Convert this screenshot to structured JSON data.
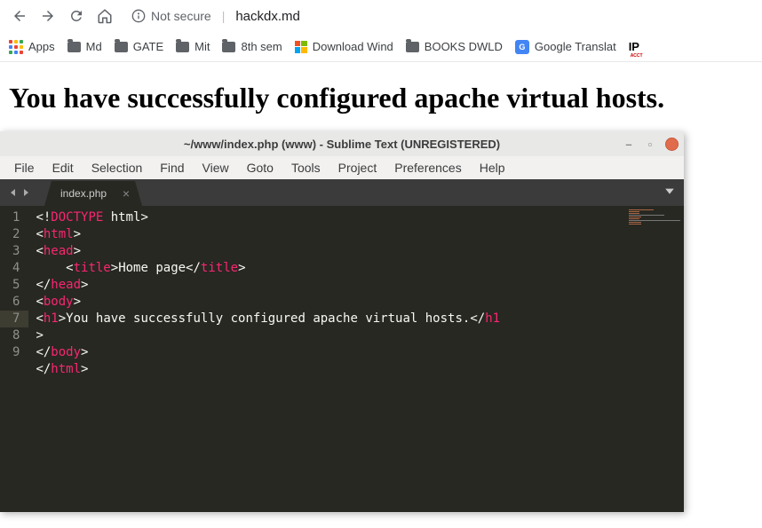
{
  "browser": {
    "security_label": "Not secure",
    "url": "hackdx.md"
  },
  "bookmarks": {
    "apps_label": "Apps",
    "items": [
      {
        "label": "Md",
        "icon": "folder"
      },
      {
        "label": "GATE",
        "icon": "folder"
      },
      {
        "label": "Mit",
        "icon": "folder"
      },
      {
        "label": "8th sem",
        "icon": "folder"
      },
      {
        "label": "Download Wind",
        "icon": "windows"
      },
      {
        "label": "BOOKS DWLD",
        "icon": "folder"
      },
      {
        "label": "Google Translat",
        "icon": "gtranslate"
      },
      {
        "label": "IP",
        "icon": "ip"
      }
    ]
  },
  "page": {
    "heading": "You have successfully configured apache virtual hosts."
  },
  "sublime": {
    "title": "~/www/index.php (www) - Sublime Text (UNREGISTERED)",
    "menu": [
      "File",
      "Edit",
      "Selection",
      "Find",
      "View",
      "Goto",
      "Tools",
      "Project",
      "Preferences",
      "Help"
    ],
    "tab_name": "index.php",
    "gutter": [
      "1",
      "2",
      "3",
      "4",
      "5",
      "6",
      "7",
      "",
      "8",
      "9"
    ],
    "code": {
      "l1": {
        "p1": "<!",
        "kw": "DOCTYPE",
        "p2": " ",
        "txt": "html",
        "p3": ">"
      },
      "l2": {
        "p1": "<",
        "kw": "html",
        "p2": ">"
      },
      "l3": {
        "p1": "<",
        "kw": "head",
        "p2": ">"
      },
      "l4": {
        "indent": "    ",
        "p1": "<",
        "kw1": "title",
        "p2": ">",
        "txt": "Home page",
        "p3": "</",
        "kw2": "title",
        "p4": ">"
      },
      "l5": {
        "p1": "</",
        "kw": "head",
        "p2": ">"
      },
      "l6": {
        "p1": "<",
        "kw": "body",
        "p2": ">"
      },
      "l7a": {
        "p1": "<",
        "kw": "h1",
        "p2": ">",
        "txt": "You have successfully configured apache virtual hosts.",
        "p3": "</",
        "kw2": "h1"
      },
      "l7b": {
        "p1": ">"
      },
      "l8": {
        "p1": "</",
        "kw": "body",
        "p2": ">"
      },
      "l9": {
        "p1": "</",
        "kw": "html",
        "p2": ">"
      }
    }
  }
}
